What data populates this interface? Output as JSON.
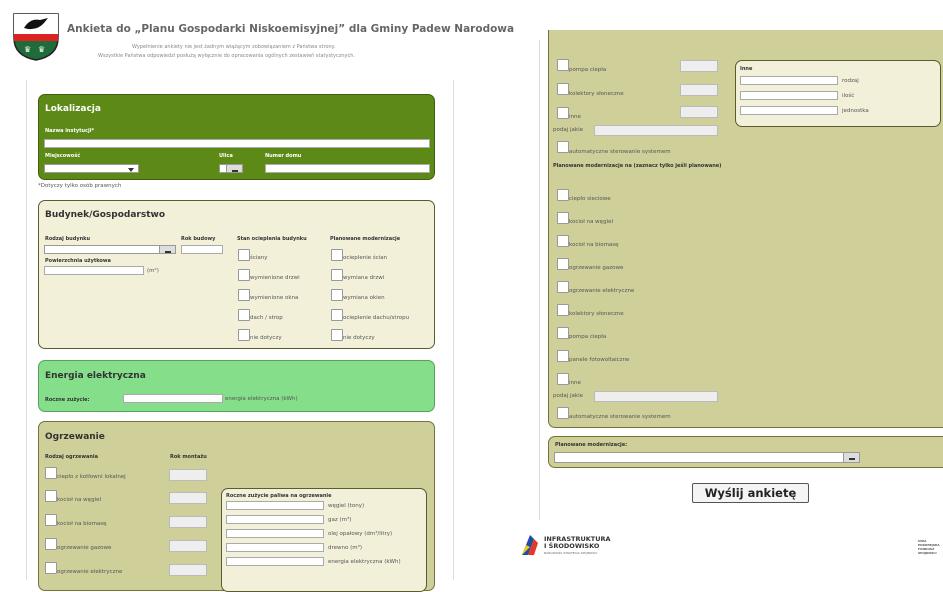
{
  "header": {
    "title": "Ankieta do „Planu Gospodarki Niskoemisyjnej” dla Gminy Padew Narodowa",
    "subtitle1": "Wypełnienie ankiety nie jest żadnym wiążącym zobowiązaniem z Państwa strony.",
    "subtitle2": "Wszystkie Państwa odpowiedzi posłużą wyłącznie do opracowania ogólnych zestawień statystycznych."
  },
  "lokalizacja": {
    "title": "Lokalizacja",
    "nazwa": "Nazwa instytucji*",
    "miejscowosc": "Miejscowość",
    "ulica": "Ulica",
    "numer": "Numer domu",
    "note": "*Dotyczy tylko osób prawnych"
  },
  "budynek": {
    "title": "Budynek/Gospodarstwo",
    "rodzaj": "Rodzaj budynku",
    "rok": "Rok budowy",
    "powierzchnia": "Powierzchnia użytkowa",
    "unit": "(m²)",
    "stan_label": "Stan ocieplenia budynku",
    "stan": [
      "ściany",
      "wymienione drzwi",
      "wymienione okna",
      "dach / strop",
      "nie dotyczy"
    ],
    "plan_label": "Planowane modernizacje",
    "plan": [
      "ocieplenie ścian",
      "wymiana drzwi",
      "wymiana okien",
      "ocieplenie dachu/stropu",
      "nie dotyczy"
    ]
  },
  "energia": {
    "title": "Energia elektryczna",
    "roczne": "Roczne zużycie:",
    "unit": "energia elektryczna (kWh)"
  },
  "ogrzewanie": {
    "title": "Ogrzewanie",
    "rodzaj": "Rodzaj ogrzewania",
    "rok": "Rok montażu",
    "items": [
      "ciepło z kotłowni lokalnej",
      "kocioł na węgiel",
      "kocioł na biomasę",
      "ogrzewanie gazowe",
      "ogrzewanie elektryczne"
    ],
    "paliwo_label": "Roczne zużycie paliwa na ogrzewanie",
    "paliwa": [
      "węgiel (tony)",
      "gaz (m³)",
      "olej opałowy (dm³/litry)",
      "drewno (m³)",
      "energia elektryczna (kWh)"
    ]
  },
  "right": {
    "top_items": [
      "pompa ciepła",
      "kolektory słoneczne",
      "inne"
    ],
    "inne_title": "Inne",
    "inne_fields": [
      "rodzaj",
      "ilość",
      "jednostka"
    ],
    "podaj": "podaj jakie",
    "auto": "automatyczne sterowanie systemem",
    "plan_label": "Planowane modernizacje na (zaznacz tylko jeśli planowane)",
    "plan_items": [
      "ciepło sieciowe",
      "kocioł na węgiel",
      "kocioł na biomasę",
      "ogrzewanie gazowe",
      "ogrzewanie elektryczne",
      "kolektory słoneczne",
      "pompa ciepła",
      "panele fotowoltaiczne",
      "inne"
    ],
    "podaj2": "podaj jakie",
    "auto2": "automatyczne sterowanie systemem",
    "modern_label": "Planowane modernizacje:",
    "submit": "Wyślij ankietę"
  },
  "footer": {
    "line1": "INFRASTRUKTURA",
    "line2": "I ŚRODOWISKO",
    "small": "NARODOWA STRATEGIA SPÓJNOŚCI",
    "eu": "UNIA EUROPEJSKA",
    "eu2": "FUNDUSZ SPÓJNOŚCI"
  },
  "colors": {
    "green": "#5d8a17",
    "lightgreen": "#85de8a",
    "beige": "#f2f0d9",
    "olive": "#cfcf9a"
  }
}
